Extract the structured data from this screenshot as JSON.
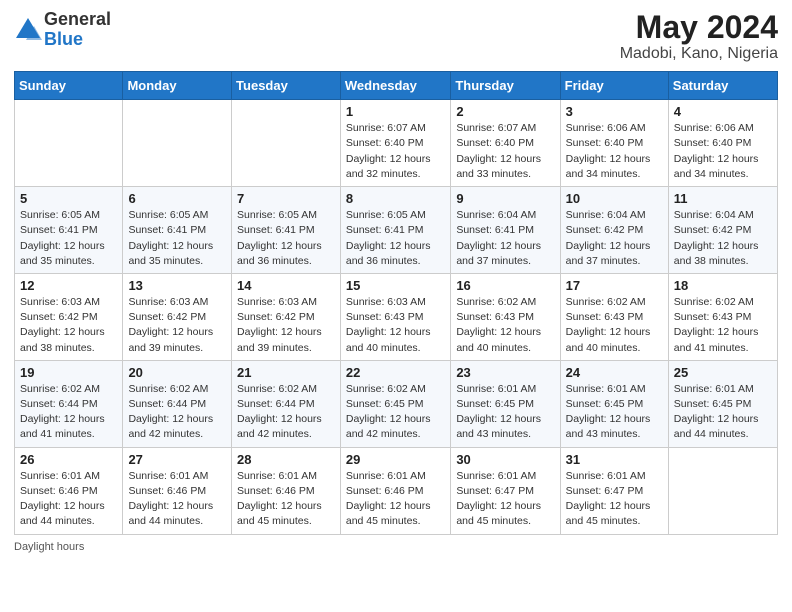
{
  "header": {
    "logo_general": "General",
    "logo_blue": "Blue",
    "title": "May 2024",
    "location": "Madobi, Kano, Nigeria"
  },
  "weekdays": [
    "Sunday",
    "Monday",
    "Tuesday",
    "Wednesday",
    "Thursday",
    "Friday",
    "Saturday"
  ],
  "weeks": [
    [
      {
        "day": "",
        "info": ""
      },
      {
        "day": "",
        "info": ""
      },
      {
        "day": "",
        "info": ""
      },
      {
        "day": "1",
        "info": "Sunrise: 6:07 AM\nSunset: 6:40 PM\nDaylight: 12 hours\nand 32 minutes."
      },
      {
        "day": "2",
        "info": "Sunrise: 6:07 AM\nSunset: 6:40 PM\nDaylight: 12 hours\nand 33 minutes."
      },
      {
        "day": "3",
        "info": "Sunrise: 6:06 AM\nSunset: 6:40 PM\nDaylight: 12 hours\nand 34 minutes."
      },
      {
        "day": "4",
        "info": "Sunrise: 6:06 AM\nSunset: 6:40 PM\nDaylight: 12 hours\nand 34 minutes."
      }
    ],
    [
      {
        "day": "5",
        "info": "Sunrise: 6:05 AM\nSunset: 6:41 PM\nDaylight: 12 hours\nand 35 minutes."
      },
      {
        "day": "6",
        "info": "Sunrise: 6:05 AM\nSunset: 6:41 PM\nDaylight: 12 hours\nand 35 minutes."
      },
      {
        "day": "7",
        "info": "Sunrise: 6:05 AM\nSunset: 6:41 PM\nDaylight: 12 hours\nand 36 minutes."
      },
      {
        "day": "8",
        "info": "Sunrise: 6:05 AM\nSunset: 6:41 PM\nDaylight: 12 hours\nand 36 minutes."
      },
      {
        "day": "9",
        "info": "Sunrise: 6:04 AM\nSunset: 6:41 PM\nDaylight: 12 hours\nand 37 minutes."
      },
      {
        "day": "10",
        "info": "Sunrise: 6:04 AM\nSunset: 6:42 PM\nDaylight: 12 hours\nand 37 minutes."
      },
      {
        "day": "11",
        "info": "Sunrise: 6:04 AM\nSunset: 6:42 PM\nDaylight: 12 hours\nand 38 minutes."
      }
    ],
    [
      {
        "day": "12",
        "info": "Sunrise: 6:03 AM\nSunset: 6:42 PM\nDaylight: 12 hours\nand 38 minutes."
      },
      {
        "day": "13",
        "info": "Sunrise: 6:03 AM\nSunset: 6:42 PM\nDaylight: 12 hours\nand 39 minutes."
      },
      {
        "day": "14",
        "info": "Sunrise: 6:03 AM\nSunset: 6:42 PM\nDaylight: 12 hours\nand 39 minutes."
      },
      {
        "day": "15",
        "info": "Sunrise: 6:03 AM\nSunset: 6:43 PM\nDaylight: 12 hours\nand 40 minutes."
      },
      {
        "day": "16",
        "info": "Sunrise: 6:02 AM\nSunset: 6:43 PM\nDaylight: 12 hours\nand 40 minutes."
      },
      {
        "day": "17",
        "info": "Sunrise: 6:02 AM\nSunset: 6:43 PM\nDaylight: 12 hours\nand 40 minutes."
      },
      {
        "day": "18",
        "info": "Sunrise: 6:02 AM\nSunset: 6:43 PM\nDaylight: 12 hours\nand 41 minutes."
      }
    ],
    [
      {
        "day": "19",
        "info": "Sunrise: 6:02 AM\nSunset: 6:44 PM\nDaylight: 12 hours\nand 41 minutes."
      },
      {
        "day": "20",
        "info": "Sunrise: 6:02 AM\nSunset: 6:44 PM\nDaylight: 12 hours\nand 42 minutes."
      },
      {
        "day": "21",
        "info": "Sunrise: 6:02 AM\nSunset: 6:44 PM\nDaylight: 12 hours\nand 42 minutes."
      },
      {
        "day": "22",
        "info": "Sunrise: 6:02 AM\nSunset: 6:45 PM\nDaylight: 12 hours\nand 42 minutes."
      },
      {
        "day": "23",
        "info": "Sunrise: 6:01 AM\nSunset: 6:45 PM\nDaylight: 12 hours\nand 43 minutes."
      },
      {
        "day": "24",
        "info": "Sunrise: 6:01 AM\nSunset: 6:45 PM\nDaylight: 12 hours\nand 43 minutes."
      },
      {
        "day": "25",
        "info": "Sunrise: 6:01 AM\nSunset: 6:45 PM\nDaylight: 12 hours\nand 44 minutes."
      }
    ],
    [
      {
        "day": "26",
        "info": "Sunrise: 6:01 AM\nSunset: 6:46 PM\nDaylight: 12 hours\nand 44 minutes."
      },
      {
        "day": "27",
        "info": "Sunrise: 6:01 AM\nSunset: 6:46 PM\nDaylight: 12 hours\nand 44 minutes."
      },
      {
        "day": "28",
        "info": "Sunrise: 6:01 AM\nSunset: 6:46 PM\nDaylight: 12 hours\nand 45 minutes."
      },
      {
        "day": "29",
        "info": "Sunrise: 6:01 AM\nSunset: 6:46 PM\nDaylight: 12 hours\nand 45 minutes."
      },
      {
        "day": "30",
        "info": "Sunrise: 6:01 AM\nSunset: 6:47 PM\nDaylight: 12 hours\nand 45 minutes."
      },
      {
        "day": "31",
        "info": "Sunrise: 6:01 AM\nSunset: 6:47 PM\nDaylight: 12 hours\nand 45 minutes."
      },
      {
        "day": "",
        "info": ""
      }
    ]
  ],
  "footer": {
    "note": "Daylight hours"
  }
}
